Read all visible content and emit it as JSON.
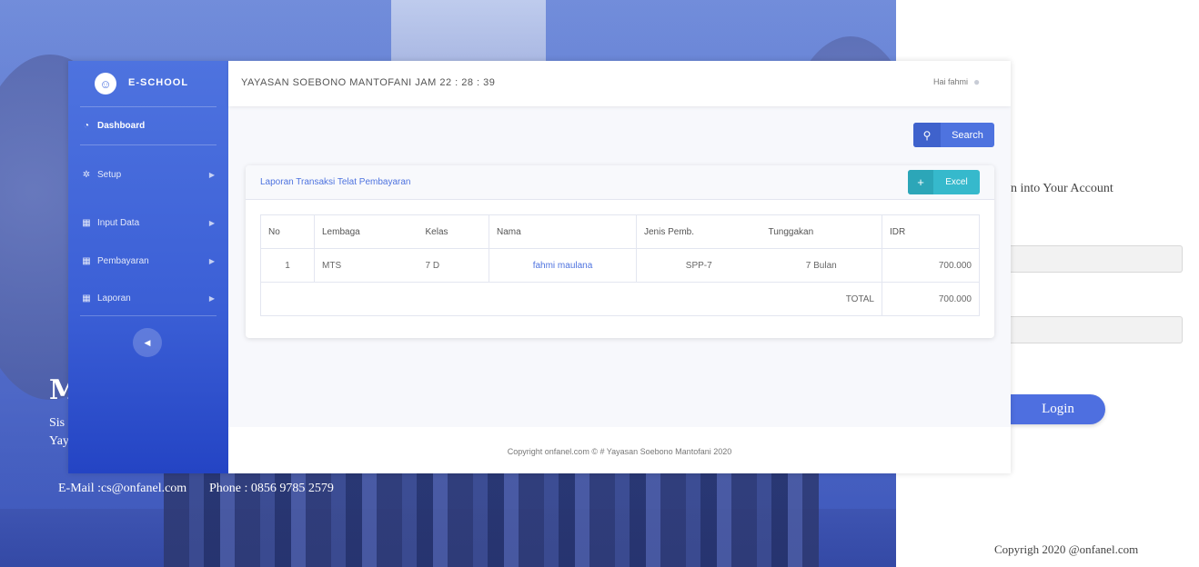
{
  "background": {
    "hero_title": "M",
    "hero_sub1": "Sis",
    "hero_sub2": "Yay",
    "email": "E-Mail :cs@onfanel.com",
    "phone": "Phone : 0856 9785 2579",
    "login_subtitle": "n into Your Account",
    "login_button": "Login",
    "copyright": "Copyrigh 2020 @onfanel.com"
  },
  "sidebar": {
    "brand": "E-SCHOOL",
    "brand_icon": "smile-logo-icon",
    "items": [
      {
        "label": "Dashboard",
        "icon": "tachometer-icon"
      },
      {
        "label": "Setup",
        "icon": "gear-icon"
      },
      {
        "label": "Input Data",
        "icon": "table-icon"
      },
      {
        "label": "Pembayaran",
        "icon": "table-icon"
      },
      {
        "label": "Laporan",
        "icon": "table-icon"
      }
    ]
  },
  "topbar": {
    "title": "YAYASAN SOEBONO MANTOFANI  JAM 22 : 28 : 39",
    "user": "Hai fahmi"
  },
  "toolbar": {
    "search_label": "Search"
  },
  "report": {
    "title": "Laporan Transaksi Telat Pembayaran",
    "excel_label": "Excel",
    "columns": [
      "No",
      "Lembaga",
      "Kelas",
      "Nama",
      "Jenis Pemb.",
      "Tunggakan",
      "IDR"
    ],
    "rows": [
      {
        "no": "1",
        "lembaga": "MTS",
        "kelas": "7 D",
        "nama": "fahmi maulana",
        "jenis": "SPP-7",
        "tunggakan": "7 Bulan",
        "idr": "700.000"
      }
    ],
    "total_label": "TOTAL",
    "total_value": "700.000"
  },
  "footer": {
    "text": "Copyright onfanel.com © # Yayasan Soebono Mantofani 2020"
  },
  "colors": {
    "primary": "#4e73df",
    "info": "#36b9cc"
  }
}
